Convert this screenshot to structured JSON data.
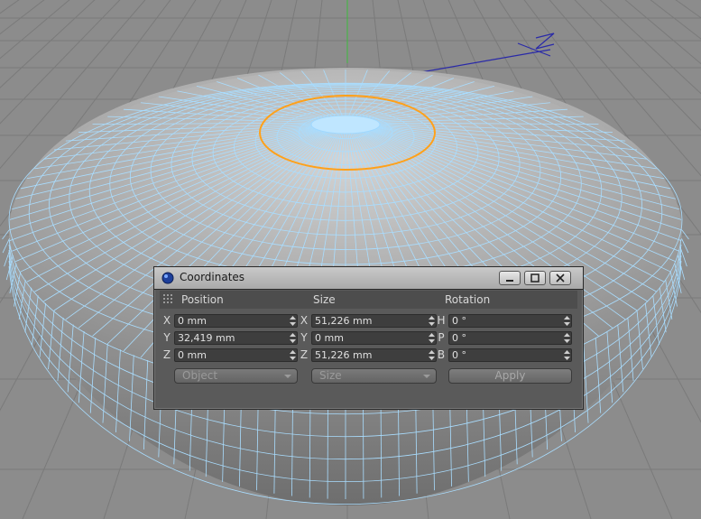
{
  "viewport": {
    "content": "3D wireframe flattened ellipsoid in perspective viewport"
  },
  "coordinates": {
    "title": "Coordinates",
    "columns": {
      "position": "Position",
      "size": "Size",
      "rotation": "Rotation"
    },
    "position": [
      {
        "axis": "X",
        "value": "0 mm"
      },
      {
        "axis": "Y",
        "value": "32,419 mm"
      },
      {
        "axis": "Z",
        "value": "0 mm"
      }
    ],
    "size": [
      {
        "axis": "X",
        "value": "51,226 mm"
      },
      {
        "axis": "Y",
        "value": "0 mm"
      },
      {
        "axis": "Z",
        "value": "51,226 mm"
      }
    ],
    "rotation": [
      {
        "axis": "H",
        "value": "0 °"
      },
      {
        "axis": "P",
        "value": "0 °"
      },
      {
        "axis": "B",
        "value": "0 °"
      }
    ],
    "mode_dropdown": "Object",
    "size_dropdown": "Size",
    "apply_label": "Apply"
  },
  "colors": {
    "wire": "#a9ddff",
    "selection": "#ffa11a",
    "axis_y": "#3cba3c",
    "axis_z": "#2a2aa8"
  }
}
